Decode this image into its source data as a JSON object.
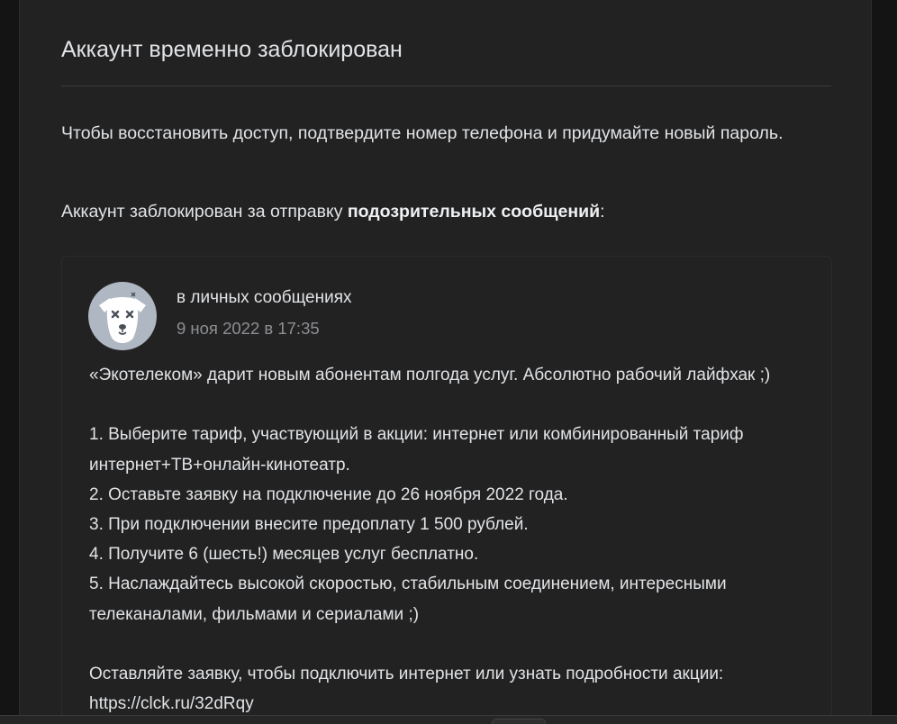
{
  "colors": {
    "page_background": "#141414",
    "card_background": "#222222",
    "text_primary": "#e1e3e6",
    "text_secondary": "#8d8f93",
    "avatar_background": "#aeb7c2"
  },
  "dialog": {
    "title": "Аккаунт временно заблокирован",
    "restore_text": "Чтобы восстановить доступ, подтвердите номер телефона и придумайте новый пароль.",
    "reason_prefix": "Аккаунт заблокирован за отправку ",
    "reason_bold": "подозрительных сообщений",
    "reason_suffix": ":"
  },
  "message": {
    "avatar_icon": "deactivated-dog-avatar-icon",
    "source": "в личных сообщениях",
    "date": "9 ноя 2022 в 17:35",
    "lines": [
      "«Экотелеком» дарит новым абонентам полгода услуг. Абсолютно рабочий лайфхак ;)",
      "",
      "1. Выберите тариф, участвующий в акции: интернет или комбинированный тариф",
      "интернет+ТВ+онлайн-кинотеатр.",
      "2. Оставьте заявку на подключение до 26 ноября 2022 года.",
      "3. При подключении внесите предоплату 1 500 рублей.",
      "4. Получите 6 (шесть!) месяцев услуг бесплатно.",
      "5. Наслаждайтесь высокой скоростью, стабильным соединением, интересными",
      "телеканалами, фильмами и сериалами ;)",
      "",
      "Оставляйте заявку, чтобы подключить интернет или узнать подробности акции:",
      "https://clck.ru/32dRqy"
    ]
  }
}
